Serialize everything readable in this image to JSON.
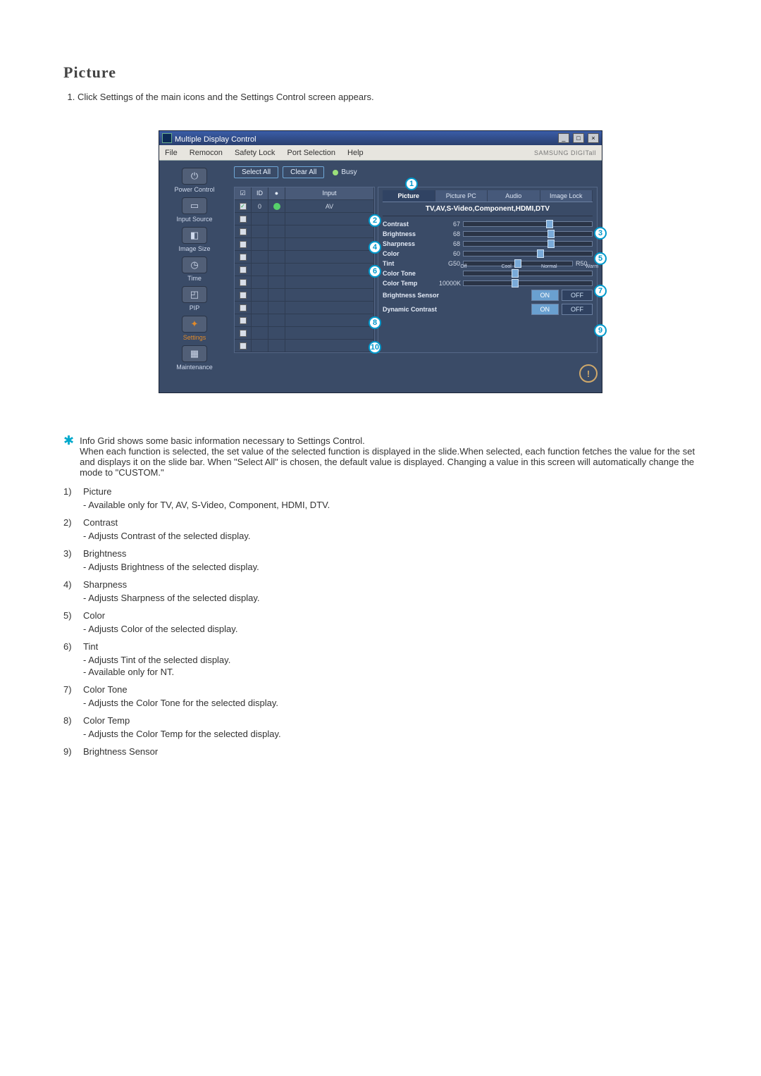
{
  "page": {
    "title": "Picture",
    "intro_item": "Click Settings of the main icons and the Settings Control screen appears."
  },
  "window": {
    "title": "Multiple Display Control",
    "brand": "SAMSUNG DIGITall",
    "win_min": "_",
    "win_max": "□",
    "win_close": "×",
    "menu": [
      "File",
      "Remocon",
      "Safety Lock",
      "Port Selection",
      "Help"
    ],
    "btn_select_all": "Select All",
    "btn_clear_all": "Clear All",
    "busy": "Busy",
    "sidebar": [
      {
        "label": "Power Control",
        "glyph": "⏻",
        "active": false
      },
      {
        "label": "Input Source",
        "glyph": "▭",
        "active": false
      },
      {
        "label": "Image Size",
        "glyph": "◧",
        "active": false
      },
      {
        "label": "Time",
        "glyph": "◷",
        "active": false
      },
      {
        "label": "PIP",
        "glyph": "◰",
        "active": false
      },
      {
        "label": "Settings",
        "glyph": "✦",
        "active": true
      },
      {
        "label": "Maintenance",
        "glyph": "▦",
        "active": false
      }
    ],
    "grid": {
      "h_chk": "☑",
      "h_id": "ID",
      "h_led": "●",
      "h_input": "Input",
      "rows": [
        {
          "chk": true,
          "id": "0",
          "led": true,
          "input": "AV"
        },
        {
          "chk": false,
          "id": "",
          "led": false,
          "input": ""
        },
        {
          "chk": false,
          "id": "",
          "led": false,
          "input": ""
        },
        {
          "chk": false,
          "id": "",
          "led": false,
          "input": ""
        },
        {
          "chk": false,
          "id": "",
          "led": false,
          "input": ""
        },
        {
          "chk": false,
          "id": "",
          "led": false,
          "input": ""
        },
        {
          "chk": false,
          "id": "",
          "led": false,
          "input": ""
        },
        {
          "chk": false,
          "id": "",
          "led": false,
          "input": ""
        },
        {
          "chk": false,
          "id": "",
          "led": false,
          "input": ""
        },
        {
          "chk": false,
          "id": "",
          "led": false,
          "input": ""
        },
        {
          "chk": false,
          "id": "",
          "led": false,
          "input": ""
        },
        {
          "chk": false,
          "id": "",
          "led": false,
          "input": ""
        }
      ]
    },
    "panel": {
      "tabs": [
        "Picture",
        "Picture PC",
        "Audio",
        "Image Lock"
      ],
      "active_tab": 0,
      "subtitle": "TV,AV,S-Video,Component,HDMI,DTV",
      "sliders": [
        {
          "label": "Contrast",
          "val": "67",
          "pos": 67
        },
        {
          "label": "Brightness",
          "val": "68",
          "pos": 68
        },
        {
          "label": "Sharpness",
          "val": "68",
          "pos": 68
        },
        {
          "label": "Color",
          "val": "60",
          "pos": 60
        }
      ],
      "tint": {
        "label": "Tint",
        "left": "G50",
        "right": "R50",
        "pos": 50
      },
      "colortone": {
        "label": "Color Tone",
        "notches": [
          "Off",
          "Cool",
          "Normal",
          "Warm"
        ],
        "pos": 40
      },
      "colortemp": {
        "label": "Color Temp",
        "val": "10000K",
        "pos": 40
      },
      "toggles": [
        {
          "label": "Brightness Sensor",
          "on": "ON",
          "off": "OFF",
          "state": "on"
        },
        {
          "label": "Dynamic Contrast",
          "on": "ON",
          "off": "OFF",
          "state": "on"
        }
      ]
    },
    "callouts": [
      "1",
      "2",
      "3",
      "4",
      "5",
      "6",
      "7",
      "8",
      "9",
      "10"
    ],
    "footer_warn": "!"
  },
  "doc": {
    "info_para": "Info Grid shows some basic information necessary to Settings Control.\nWhen each function is selected, the set value of the selected function is displayed in the slide.When selected, each function fetches the value for the set and displays it on the slide bar. When \"Select All\" is chosen, the default value is displayed. Changing a value in this screen will automatically change the mode to \"CUSTOM.\"",
    "items": [
      {
        "n": "1)",
        "h": "Picture",
        "desc": [
          "- Available only for TV, AV, S-Video, Component, HDMI, DTV."
        ]
      },
      {
        "n": "2)",
        "h": "Contrast",
        "desc": [
          "- Adjusts Contrast of the selected display."
        ]
      },
      {
        "n": "3)",
        "h": "Brightness",
        "desc": [
          "- Adjusts Brightness of the selected display."
        ]
      },
      {
        "n": "4)",
        "h": "Sharpness",
        "desc": [
          "- Adjusts Sharpness of the selected display."
        ]
      },
      {
        "n": "5)",
        "h": "Color",
        "desc": [
          "- Adjusts Color of the selected display."
        ]
      },
      {
        "n": "6)",
        "h": "Tint",
        "desc": [
          "- Adjusts Tint of the selected display.",
          "- Available  only for NT."
        ]
      },
      {
        "n": "7)",
        "h": "Color Tone",
        "desc": [
          "- Adjusts the Color Tone for the selected display."
        ]
      },
      {
        "n": "8)",
        "h": "Color Temp",
        "desc": [
          "- Adjusts the Color Temp for the selected display."
        ]
      },
      {
        "n": "9)",
        "h": "Brightness Sensor",
        "desc": []
      }
    ]
  }
}
